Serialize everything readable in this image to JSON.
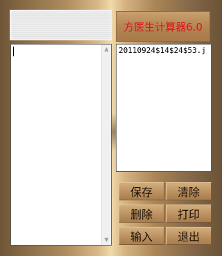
{
  "window": {
    "title_button": "方医生计算器6.0"
  },
  "left_panel": {
    "text": ""
  },
  "right_panel": {
    "text": "20110924$14$24$53.j"
  },
  "buttons": {
    "save": "保存",
    "clear": "清除",
    "delete": "删除",
    "print": "打印",
    "input": "输入",
    "exit": "退出"
  },
  "scrollbar": {
    "up_icon": "▲",
    "down_icon": "▼"
  }
}
